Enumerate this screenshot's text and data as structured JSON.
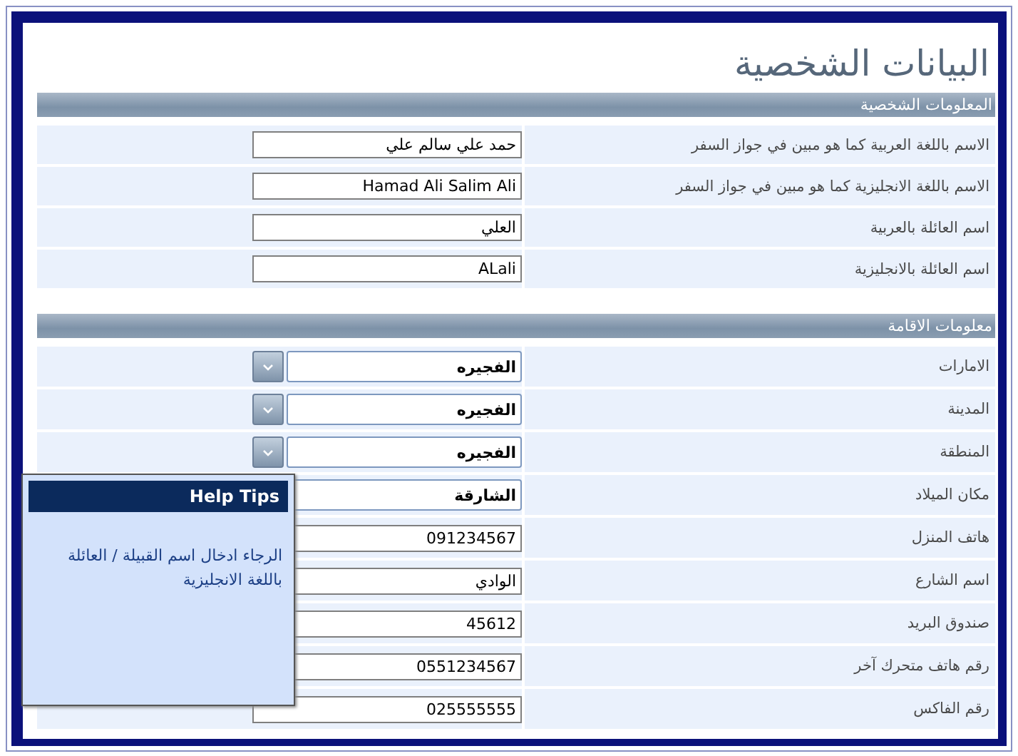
{
  "title": "البيانات الشخصية",
  "sections": [
    {
      "heading": "المعلومات الشخصية",
      "fields": [
        {
          "kind": "text",
          "label": "الاسم باللغة العربية كما هو مبين في جواز السفر",
          "value": "حمد علي سالم علي"
        },
        {
          "kind": "text",
          "label": "الاسم باللغة الانجليزية كما هو مبين في جواز السفر",
          "value": "Hamad Ali Salim Ali"
        },
        {
          "kind": "text",
          "label": "اسم العائلة بالعربية",
          "value": "العلي"
        },
        {
          "kind": "text",
          "label": "اسم العائلة بالانجليزية",
          "value": "ALali"
        }
      ]
    },
    {
      "heading": "معلومات الاقامة",
      "fields": [
        {
          "kind": "select",
          "label": "الامارات",
          "value": "الفجيره"
        },
        {
          "kind": "select",
          "label": "المدينة",
          "value": "الفجيره"
        },
        {
          "kind": "select",
          "label": "المنطقة",
          "value": "الفجيره"
        },
        {
          "kind": "select",
          "label": "مكان الميلاد",
          "value": "الشارقة"
        },
        {
          "kind": "text",
          "label": "هاتف المنزل",
          "value": "091234567"
        },
        {
          "kind": "text",
          "label": "اسم الشارع",
          "value": "الوادي"
        },
        {
          "kind": "text",
          "label": "صندوق البريد",
          "value": "45612"
        },
        {
          "kind": "text",
          "label": "رقم هاتف متحرك آخر",
          "value": "0551234567"
        },
        {
          "kind": "text",
          "label": "رقم الفاكس",
          "value": "025555555"
        }
      ]
    }
  ],
  "help_tips": {
    "title": "Help Tips",
    "text": "الرجاء ادخال اسم القبيلة / العائلة باللغة الانجليزية"
  }
}
